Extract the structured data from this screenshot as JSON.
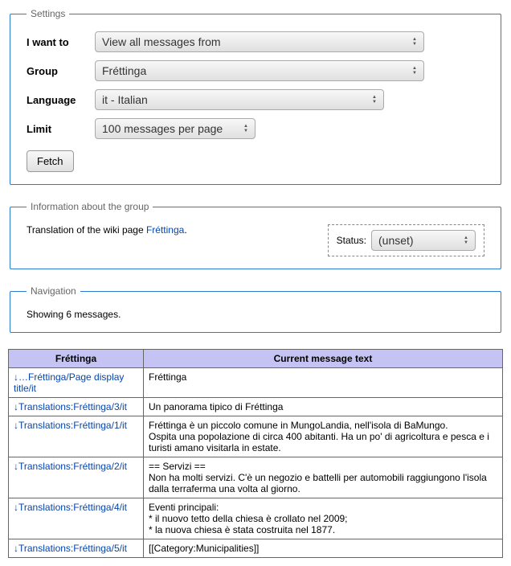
{
  "settings": {
    "legend": "Settings",
    "iWantTo": {
      "label": "I want to",
      "value": "View all messages from"
    },
    "group": {
      "label": "Group",
      "value": "Fréttinga"
    },
    "language": {
      "label": "Language",
      "value": "it - Italian"
    },
    "limit": {
      "label": "Limit",
      "value": "100 messages per page"
    },
    "fetch": "Fetch"
  },
  "info": {
    "legend": "Information about the group",
    "prefix": "Translation of the wiki page ",
    "pageLink": "Fréttinga",
    "suffix": ".",
    "statusLabel": "Status:",
    "statusValue": "(unset)"
  },
  "nav": {
    "legend": "Navigation",
    "showing": "Showing 6 messages."
  },
  "table": {
    "col1": "Fréttinga",
    "col2": "Current message text",
    "rows": [
      {
        "link": "…Fréttinga/Page display title/it",
        "text": "Fréttinga"
      },
      {
        "link": "Translations:Fréttinga/3/it",
        "text": "Un panorama tipico di Fréttinga"
      },
      {
        "link": "Translations:Fréttinga/1/it",
        "text": "Fréttinga è un piccolo comune in MungoLandia, nell'isola di BaMungo.\nOspita una popolazione di circa 400 abitanti. Ha un po' di agricoltura e pesca e i turisti amano visitarla in estate."
      },
      {
        "link": "Translations:Fréttinga/2/it",
        "text": "== Servizi ==\nNon ha molti servizi. C'è un negozio e battelli per automobili raggiungono l'isola dalla terraferma una volta al giorno."
      },
      {
        "link": "Translations:Fréttinga/4/it",
        "text": "Eventi principali:\n* il nuovo tetto della chiesa è crollato nel 2009;\n* la nuova chiesa è stata costruita nel 1877."
      },
      {
        "link": "Translations:Fréttinga/5/it",
        "text": "[[Category:Municipalities]]"
      }
    ]
  }
}
